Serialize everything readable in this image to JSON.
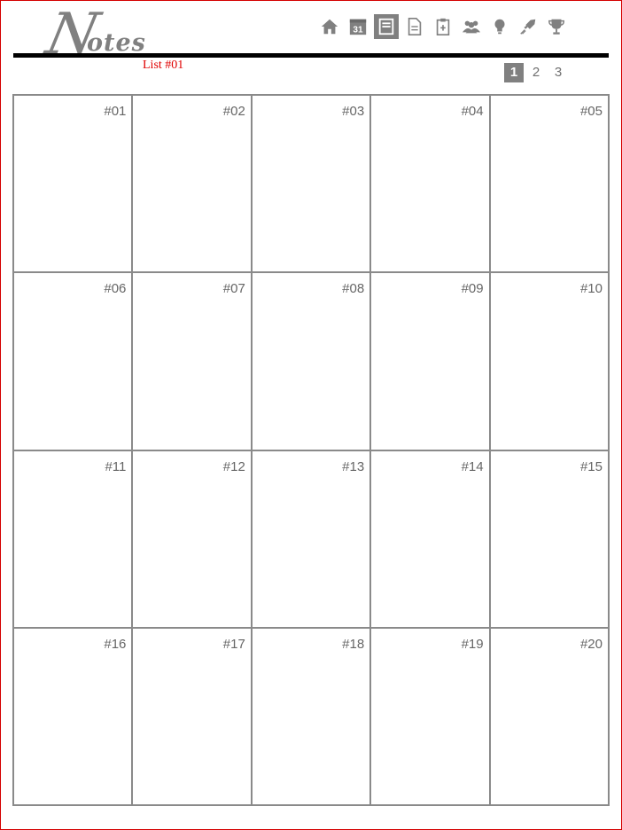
{
  "logo": {
    "initial": "N",
    "rest": "otes"
  },
  "list_label": "List #01",
  "toolbar": {
    "icons": [
      {
        "name": "home-icon",
        "active": false
      },
      {
        "name": "calendar-icon",
        "label": "31",
        "active": false
      },
      {
        "name": "notes-icon",
        "active": true
      },
      {
        "name": "document-icon",
        "active": false
      },
      {
        "name": "clipboard-icon",
        "active": false
      },
      {
        "name": "people-icon",
        "active": false
      },
      {
        "name": "lightbulb-icon",
        "active": false
      },
      {
        "name": "rocket-icon",
        "active": false
      },
      {
        "name": "trophy-icon",
        "active": false
      }
    ]
  },
  "pager": {
    "pages": [
      "1",
      "2",
      "3"
    ],
    "current": "1"
  },
  "cells": [
    "#01",
    "#02",
    "#03",
    "#04",
    "#05",
    "#06",
    "#07",
    "#08",
    "#09",
    "#10",
    "#11",
    "#12",
    "#13",
    "#14",
    "#15",
    "#16",
    "#17",
    "#18",
    "#19",
    "#20"
  ],
  "colors": {
    "border_accent": "#d40000",
    "icon_gray": "#808080",
    "label_red": "#e00000"
  }
}
